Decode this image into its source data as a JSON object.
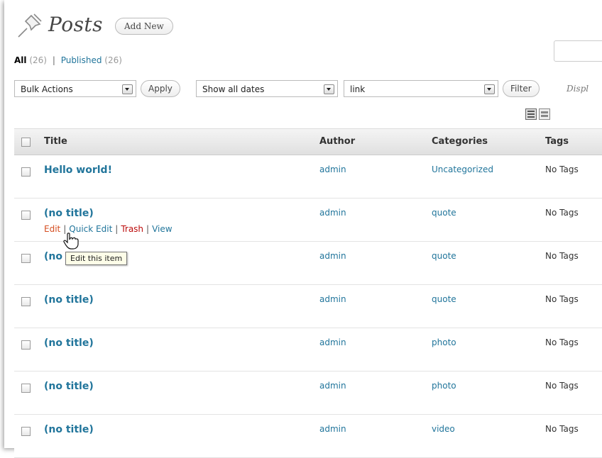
{
  "header": {
    "title": "Posts",
    "add_new_label": "Add New"
  },
  "subsubsub": {
    "all_label": "All",
    "all_count": "(26)",
    "separator": "|",
    "published_label": "Published",
    "published_count": "(26)"
  },
  "filters": {
    "bulk_actions": "Bulk Actions",
    "apply_label": "Apply",
    "dates": "Show all dates",
    "category": "link",
    "filter_label": "Filter",
    "display_partial": "Displ"
  },
  "table": {
    "columns": {
      "title": "Title",
      "author": "Author",
      "categories": "Categories",
      "tags": "Tags"
    },
    "rows": [
      {
        "title": "Hello world!",
        "author": "admin",
        "category": "Uncategorized",
        "tags": "No Tags"
      },
      {
        "title": "(no title)",
        "author": "admin",
        "category": "quote",
        "tags": "No Tags"
      },
      {
        "title": "(no title)",
        "author": "admin",
        "category": "quote",
        "tags": "No Tags"
      },
      {
        "title": "(no title)",
        "author": "admin",
        "category": "quote",
        "tags": "No Tags"
      },
      {
        "title": "(no title)",
        "author": "admin",
        "category": "photo",
        "tags": "No Tags"
      },
      {
        "title": "(no title)",
        "author": "admin",
        "category": "photo",
        "tags": "No Tags"
      },
      {
        "title": "(no title)",
        "author": "admin",
        "category": "video",
        "tags": "No Tags"
      }
    ],
    "row_actions": {
      "edit": "Edit",
      "separator": "|",
      "quick_edit": "Quick Edit",
      "trash": "Trash",
      "view": "View"
    }
  },
  "tooltip": {
    "text": "Edit this item"
  },
  "colors": {
    "link": "#21759b",
    "edit": "#d54e21",
    "trash": "#bc0b0b"
  },
  "icons": [
    "pushpin-icon",
    "list-view-icon",
    "excerpt-view-icon",
    "hand-cursor-icon"
  ]
}
